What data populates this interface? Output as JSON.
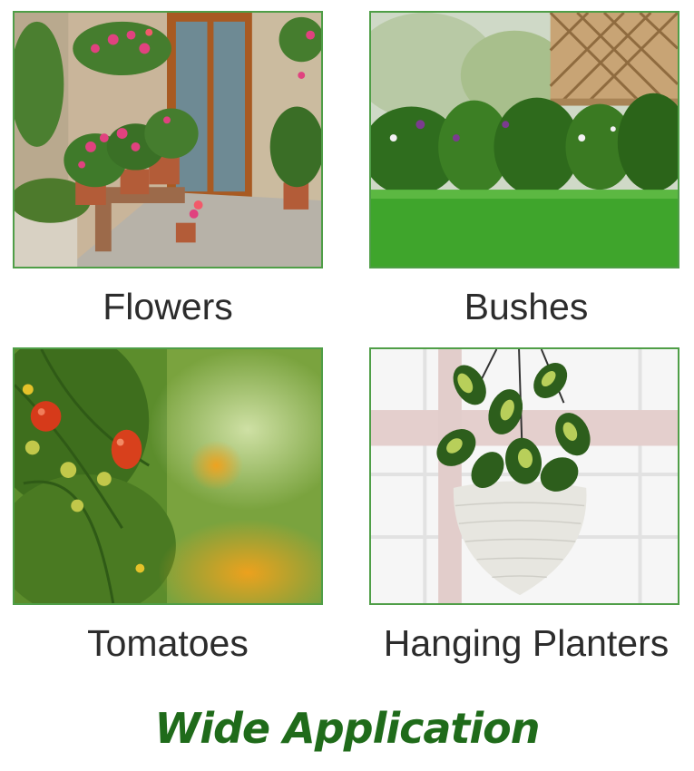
{
  "tiles": [
    {
      "caption": "Flowers"
    },
    {
      "caption": "Bushes"
    },
    {
      "caption": "Tomatoes"
    },
    {
      "caption": "Hanging Planters"
    }
  ],
  "banner": {
    "title": "Wide Application"
  },
  "colors": {
    "border": "#4f9e47",
    "banner": "#1f6b1a",
    "caption": "#2c2c2c"
  }
}
